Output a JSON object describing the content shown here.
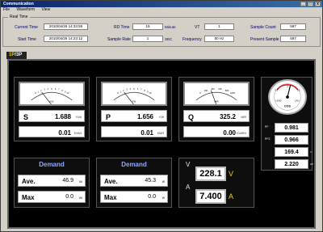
{
  "window": {
    "title": "Communication"
  },
  "menu": [
    "File",
    "Waveform",
    "View"
  ],
  "realtime": {
    "legend": "Real Time",
    "current_time_label": "Current Time",
    "current_time": "2010/04/26 14:33:59",
    "start_time_label": "Start Time",
    "start_time": "2010/04/26 14:23:12",
    "rd_time_label": "RD Time",
    "rd_time": "15",
    "rd_unit": "Minute",
    "vt_label": "VT",
    "vt": "1",
    "sample_rate_label": "Sample Rate",
    "sample_rate": "1",
    "sample_rate_unit": "SEC",
    "frequency_label": "Frequency",
    "frequency": "50 Hz",
    "sample_count_label": "Sample Count",
    "sample_count": "597",
    "present_sample_label": "Present Sample",
    "present_sample": "597"
  },
  "tabs": {
    "first": "1P",
    "sep": "/",
    "second": "3P"
  },
  "meters": {
    "s": {
      "letter": "S",
      "value": "1.688",
      "unit": "KVA",
      "sub_value": "0.01",
      "sub_unit": "KVAH",
      "gauge_unit": "KVA",
      "gauge_level": 0.17
    },
    "p": {
      "letter": "P",
      "value": "1.656",
      "unit": "KW",
      "sub_value": "0.01",
      "sub_unit": "KWH",
      "gauge_unit": "KW",
      "gauge_level": 0.17
    },
    "q": {
      "letter": "Q",
      "value": "325.2",
      "unit": "VAR",
      "sub_value": "0.00",
      "sub_unit": "KVARH",
      "gauge_unit": "VAR",
      "gauge_level": 0.33
    }
  },
  "gauge_ticks": {
    "s": [
      "0",
      "1",
      "2",
      "3",
      "4",
      "5",
      "6",
      "7",
      "8",
      "9",
      "10"
    ],
    "q": [
      "0",
      "200",
      "400",
      "600",
      "800",
      "1000"
    ]
  },
  "demand": {
    "kva": {
      "title": "Demand",
      "ave_label": "Ave.",
      "ave": "46.9",
      "ave_unit": "VA",
      "max_label": "Max",
      "max": "0.0",
      "max_unit": "VA"
    },
    "kw": {
      "title": "Demand",
      "ave_label": "Ave.",
      "ave": "45.3",
      "ave_unit": "W",
      "max_label": "Max",
      "max": "0.0",
      "max_unit": "W"
    }
  },
  "va": {
    "v_label": "V",
    "voltage": "228.1",
    "v_unit": "V",
    "a_label": "A",
    "current": "7.400",
    "a_unit": "A"
  },
  "pf": {
    "gauge_lead": "LEAD",
    "gauge_lag": "LAG",
    "gauge_label": "COS",
    "gauge_ticks": [
      "0.5",
      "1",
      "0.5"
    ],
    "rows": [
      {
        "label": "PF",
        "value": "0.981",
        "unit": ""
      },
      {
        "label": "PF2",
        "value": "0.966",
        "unit": ""
      },
      {
        "label": "",
        "value": "169.4",
        "unit": "V"
      },
      {
        "label": "",
        "value": "2.220",
        "unit": "AP"
      }
    ]
  }
}
